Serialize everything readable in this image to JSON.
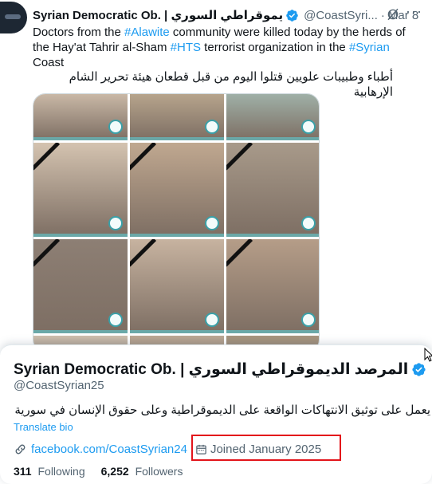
{
  "tweet": {
    "author_display_name": "Syrian Democratic Ob. | يموقراطي السوري",
    "handle": "@CoastSyri...",
    "separator": "·",
    "date": "Mar 8",
    "more_label": "···",
    "text_segments": [
      {
        "text": "Doctors from the ",
        "hashtag": false
      },
      {
        "text": "#Alawite",
        "hashtag": true
      },
      {
        "text": " community were killed today by the herds of the Hay'at Tahrir al-Sham ",
        "hashtag": false
      },
      {
        "text": "#HTS",
        "hashtag": true
      },
      {
        "text": " terrorist organization in the ",
        "hashtag": false
      },
      {
        "text": "#Syrian",
        "hashtag": true
      },
      {
        "text": " Coast",
        "hashtag": false
      }
    ],
    "arabic_text": "أطباء وطبيبات علويين قتلوا اليوم من قبل قطعان هيئة تحرير الشام الإرهابية",
    "media_alt": "Photo grid of doctors",
    "photo_count": 12
  },
  "profile_card": {
    "display_name": "Syrian Democratic Ob. | المرصد الديموقراطي السوري",
    "handle": "@CoastSyrian25",
    "bio": "يعمل على توثيق الانتهاكات الواقعة على الديموقراطية وعلى حقوق الإنسان في سورية",
    "translate_label": "Translate bio",
    "link_text": "facebook.com/CoastSyrian24",
    "joined_text": "Joined January 2025",
    "following_count": "311",
    "following_label": "Following",
    "followers_count": "6,252",
    "followers_label": "Followers"
  },
  "colors": {
    "accent": "#1d9bf0",
    "secondary_text": "#536471",
    "highlight_box": "#e3141b"
  }
}
